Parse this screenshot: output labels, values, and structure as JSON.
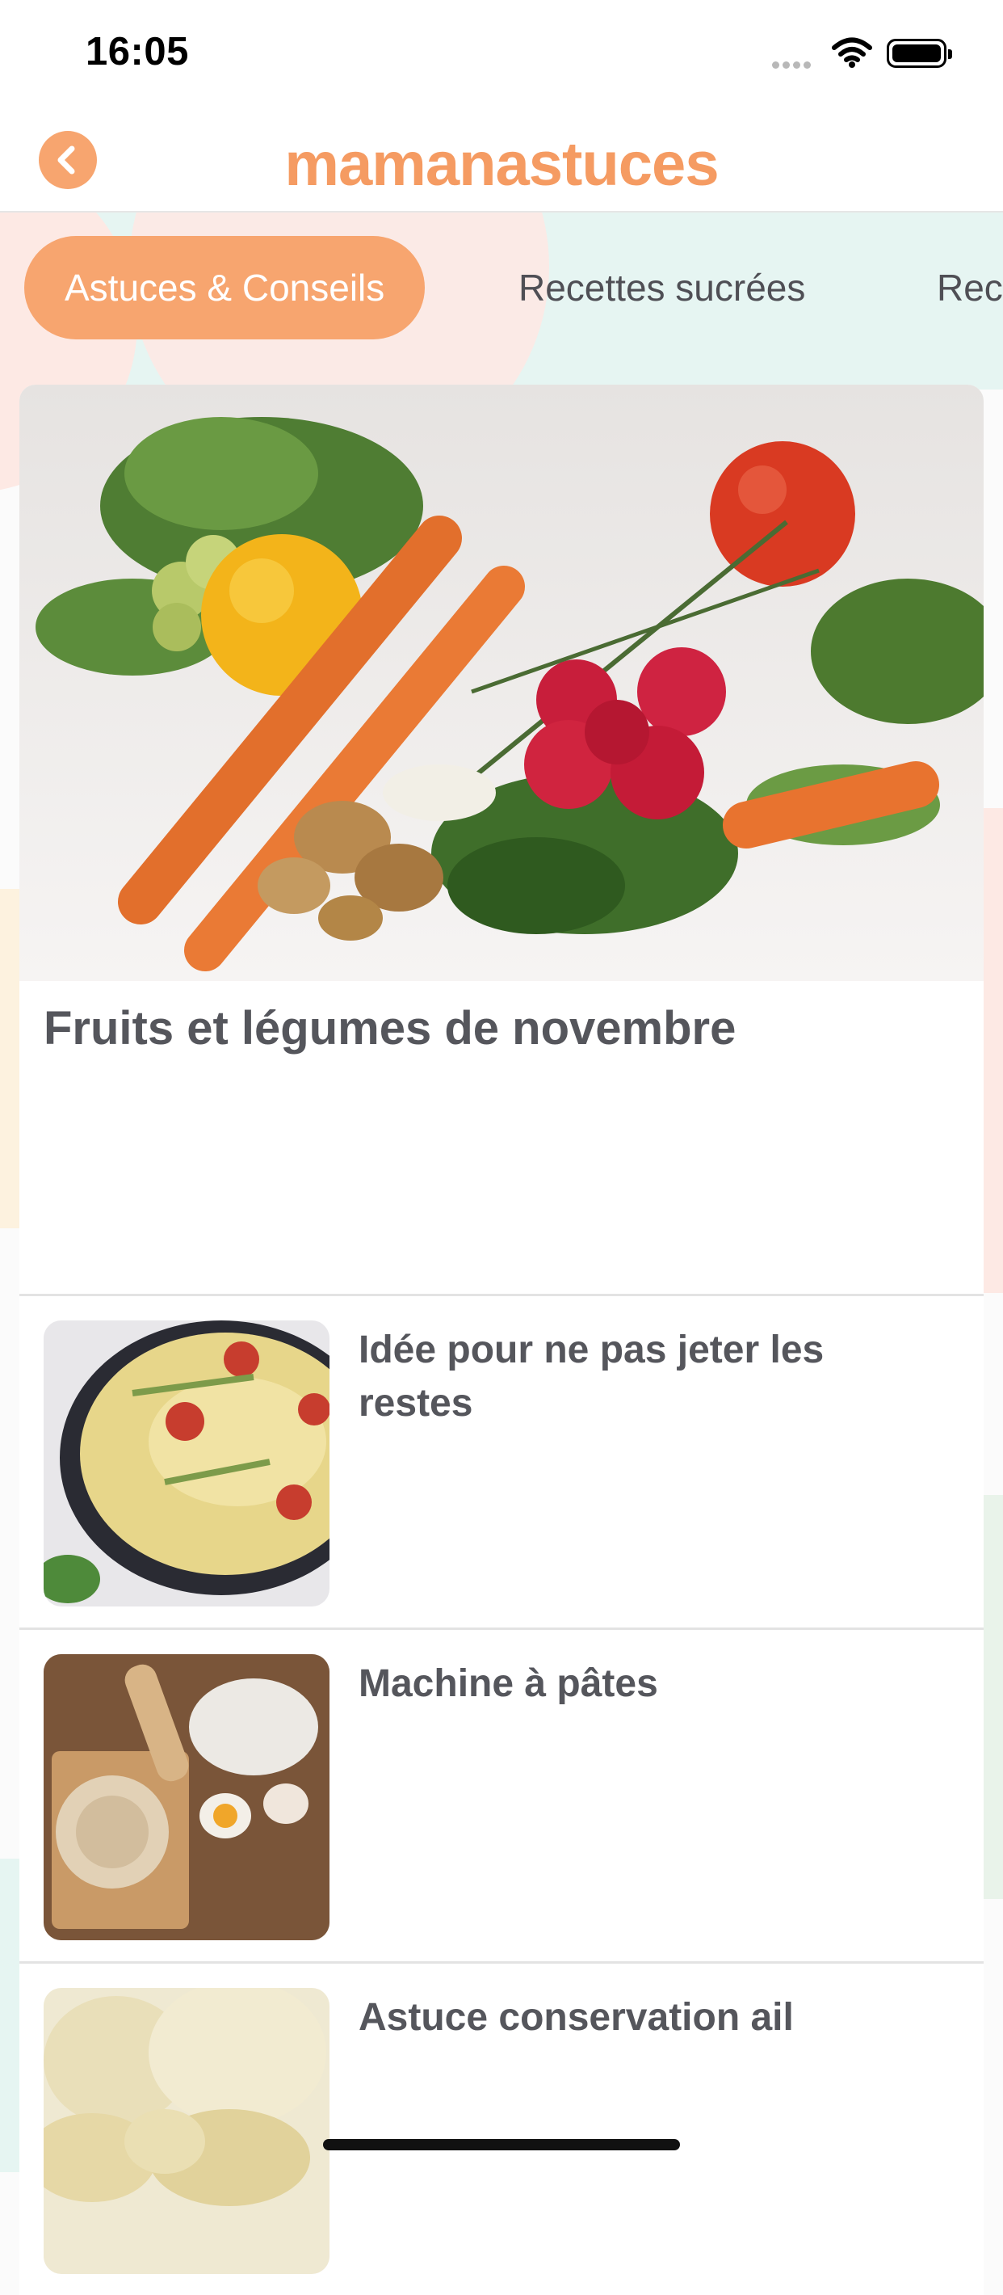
{
  "status_bar": {
    "time": "16:05"
  },
  "navbar": {
    "brand": "mamanastuces"
  },
  "tabs": [
    {
      "label": "Astuces & Conseils",
      "active": true
    },
    {
      "label": "Recettes sucrées",
      "active": false
    },
    {
      "label": "Rec",
      "active": false
    }
  ],
  "featured": {
    "title": "Fruits et légumes de novembre"
  },
  "articles": [
    {
      "title": "Idée pour ne pas jeter les restes"
    },
    {
      "title": "Machine à pâtes"
    },
    {
      "title": "Astuce conservation ail"
    }
  ],
  "colors": {
    "accent": "#f7a56f",
    "brand": "#f59b62",
    "text": "#55565c"
  },
  "icons": [
    "back-chevron-icon",
    "wifi-icon",
    "battery-icon",
    "signal-icon"
  ]
}
